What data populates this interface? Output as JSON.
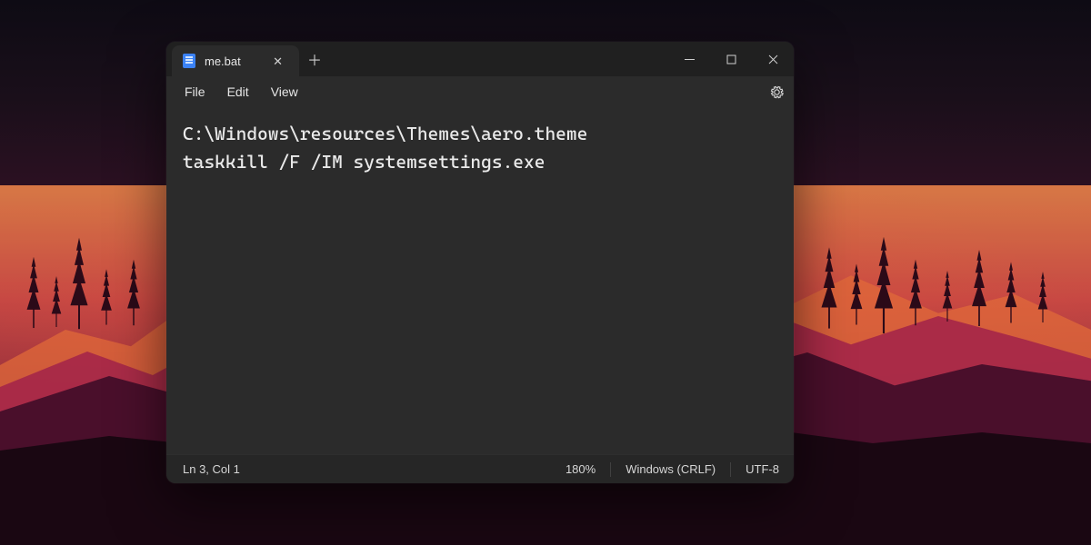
{
  "tab": {
    "title": "me.bat"
  },
  "menus": {
    "file": "File",
    "edit": "Edit",
    "view": "View"
  },
  "editor": {
    "lines": [
      "C:\\Windows\\resources\\Themes\\aero.theme",
      "taskkill /F /IM systemsettings.exe"
    ]
  },
  "status": {
    "cursor": "Ln 3, Col 1",
    "zoom": "180%",
    "line_endings": "Windows (CRLF)",
    "encoding": "UTF-8"
  },
  "icons": {
    "close_glyph": "✕",
    "plus_glyph": "＋"
  }
}
